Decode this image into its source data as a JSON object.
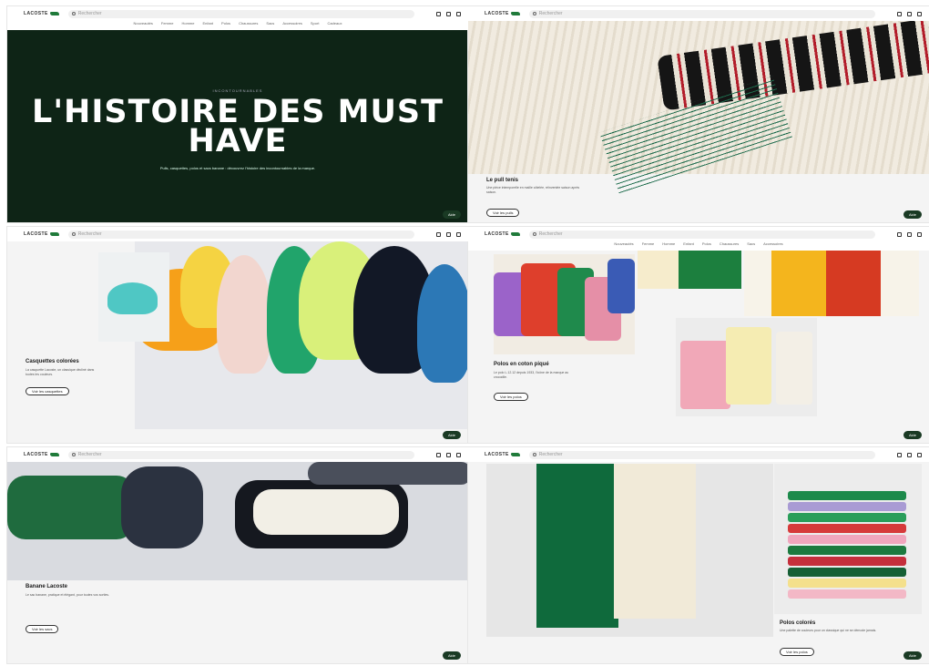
{
  "brand": {
    "name": "LACOSTE",
    "accent": "#1f7a3a",
    "dark": "#0e2416"
  },
  "search": {
    "placeholder": "Rechercher"
  },
  "help_button": "Aide",
  "nav": [
    "Nouveautés",
    "Femme",
    "Homme",
    "Enfant",
    "Polos",
    "Chaussures",
    "Sacs",
    "Accessoires",
    "Sport",
    "Cadeaux"
  ],
  "hero": {
    "kicker": "INCONTOURNABLES",
    "title": "L'HISTOIRE DES MUST HAVE",
    "subtitle": "Pulls, casquettes, polos et sacs banane : découvrez l'histoire des incontournables de la marque."
  },
  "sections": [
    {
      "title": "Le pull tenis",
      "text": "Une pièce intemporelle en maille côtelée, réinventée saison après saison.",
      "cta": "Voir les pulls"
    },
    {
      "title": "Casquettes colorées",
      "text": "La casquette Lacoste, un classique décliné dans toutes les couleurs.",
      "cta": "Voir les casquettes"
    },
    {
      "title": "Polos en coton piqué",
      "text": "Le polo L.12.12 depuis 1933, l'icône de la marque au crocodile.",
      "cta": "Voir les polos"
    },
    {
      "title": "Banane Lacoste",
      "text": "Le sac banane, pratique et élégant, pour toutes vos sorties.",
      "cta": "Voir les sacs"
    },
    {
      "title": "Polos colorés",
      "text": "Une palette de couleurs pour un classique qui ne se démode jamais.",
      "cta": "Voir les polos"
    }
  ]
}
